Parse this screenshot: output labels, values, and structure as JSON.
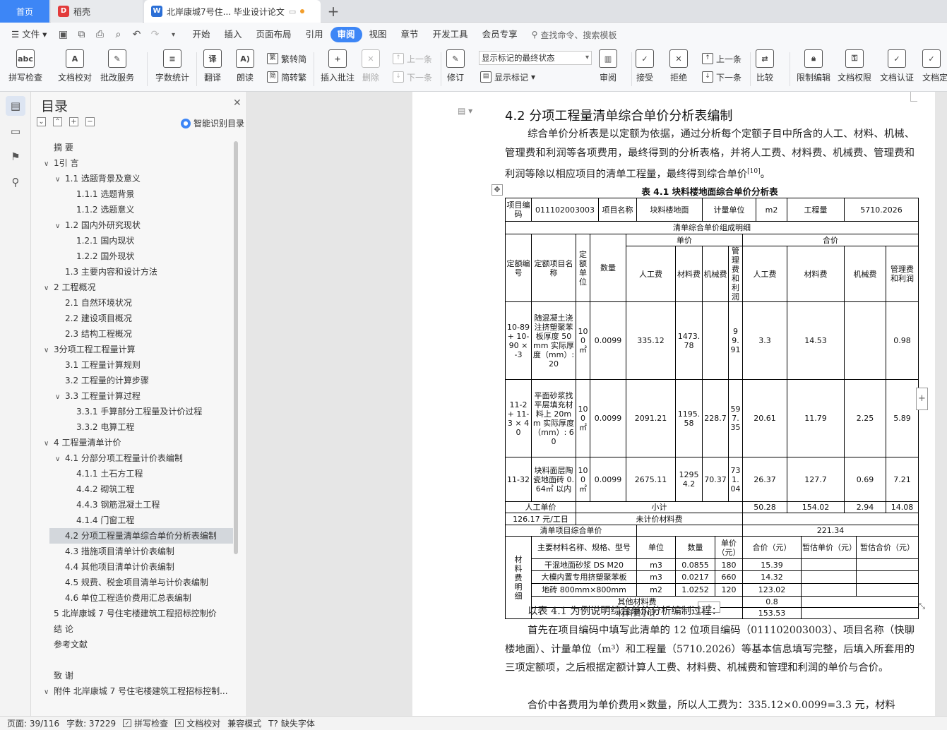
{
  "tabs": {
    "home": "首页",
    "daoke": "稻壳",
    "doc": "北岸康城7号住... 毕业设计论文",
    "new_tab": "+"
  },
  "menu": {
    "file": "文件",
    "items": [
      "开始",
      "插入",
      "页面布局",
      "引用",
      "审阅",
      "视图",
      "章节",
      "开发工具",
      "会员专享"
    ],
    "active": "审阅",
    "search": "查找命令、搜索模板"
  },
  "ribbon": {
    "spell_check": "拼写检查",
    "doc_proof": "文档校对",
    "batch_service": "批改服务",
    "word_count": "字数统计",
    "translate": "翻译",
    "read_aloud": "朗读",
    "to_trad": "繁转简",
    "to_simp": "简转繁",
    "insert_comment": "插入批注",
    "delete": "删除",
    "prev_comment": "上一条",
    "next_comment": "下一条",
    "revise": "修订",
    "markup_state": "显示标记的最终状态",
    "show_markup": "显示标记",
    "review": "审阅",
    "accept": "接受",
    "reject": "拒绝",
    "prev_change": "上一条",
    "next_change": "下一条",
    "compare": "比较",
    "restrict": "限制编辑",
    "permission": "文档权限",
    "certify": "文档认证",
    "finalize": "文档定稿"
  },
  "toc": {
    "title": "目录",
    "smart": "智能识别目录",
    "items": [
      {
        "text": "摘  要",
        "level": 0,
        "arrow": ""
      },
      {
        "text": "1引  言",
        "level": 0,
        "arrow": "v"
      },
      {
        "text": "1.1 选题背景及意义",
        "level": 1,
        "arrow": "v"
      },
      {
        "text": "1.1.1  选题背景",
        "level": 2,
        "arrow": ""
      },
      {
        "text": "1.1.2  选题意义",
        "level": 2,
        "arrow": ""
      },
      {
        "text": "1.2  国内外研究现状",
        "level": 1,
        "arrow": "v"
      },
      {
        "text": "1.2.1  国内现状",
        "level": 2,
        "arrow": ""
      },
      {
        "text": "1.2.2  国外现状",
        "level": 2,
        "arrow": ""
      },
      {
        "text": "1.3  主要内容和设计方法",
        "level": 1,
        "arrow": ""
      },
      {
        "text": "2  工程概况",
        "level": 0,
        "arrow": "v"
      },
      {
        "text": "2.1  自然环境状况",
        "level": 1,
        "arrow": ""
      },
      {
        "text": "2.2  建设项目概况",
        "level": 1,
        "arrow": ""
      },
      {
        "text": "2.3  结构工程概况",
        "level": 1,
        "arrow": ""
      },
      {
        "text": "3分项工程工程量计算",
        "level": 0,
        "arrow": "v"
      },
      {
        "text": "3.1  工程量计算规则",
        "level": 1,
        "arrow": ""
      },
      {
        "text": "3.2  工程量的计算步骤",
        "level": 1,
        "arrow": ""
      },
      {
        "text": "3.3  工程量计算过程",
        "level": 1,
        "arrow": "v"
      },
      {
        "text": "3.3.1  手算部分工程量及计价过程",
        "level": 2,
        "arrow": ""
      },
      {
        "text": "3.3.2  电算工程",
        "level": 2,
        "arrow": ""
      },
      {
        "text": "4  工程量清单计价",
        "level": 0,
        "arrow": "v"
      },
      {
        "text": "4.1  分部分项工程量计价表编制",
        "level": 1,
        "arrow": "v"
      },
      {
        "text": "4.1.1  土石方工程",
        "level": 2,
        "arrow": ""
      },
      {
        "text": "4.4.2  砌筑工程",
        "level": 2,
        "arrow": ""
      },
      {
        "text": "4.4.3  钢筋混凝土工程",
        "level": 2,
        "arrow": ""
      },
      {
        "text": "4.1.4  门窗工程",
        "level": 2,
        "arrow": ""
      },
      {
        "text": "4.2  分项工程量清单综合单价分析表编制",
        "level": 1,
        "arrow": "",
        "selected": true
      },
      {
        "text": "4.3  措施项目清单计价表编制",
        "level": 1,
        "arrow": ""
      },
      {
        "text": "4.4  其他项目清单计价表编制",
        "level": 1,
        "arrow": ""
      },
      {
        "text": "4.5  规费、税金项目清单与计价表编制",
        "level": 1,
        "arrow": ""
      },
      {
        "text": "4.6  单位工程造价费用汇总表编制",
        "level": 1,
        "arrow": ""
      },
      {
        "text": "5  北岸康城 7 号住宅楼建筑工程招标控制价",
        "level": 0,
        "arrow": ""
      },
      {
        "text": "结  论",
        "level": 0,
        "arrow": ""
      },
      {
        "text": "参考文献",
        "level": 0,
        "arrow": ""
      },
      {
        "text": "致  谢",
        "level": 0,
        "arrow": "",
        "gap": true
      },
      {
        "text": "附件  北岸康城 7 号住宅楼建筑工程招标控制...",
        "level": 0,
        "arrow": "v"
      }
    ]
  },
  "doc": {
    "heading": "4.2  分项工程量清单综合单价分析表编制",
    "para1": "综合单价分析表是以定额为依据，通过分析每个定额子目中所含的人工、材料、机械、管理费和利润等各项费用，最终得到的分析表格，并将人工费、材料费、机械费、管理费和利润等除以相应项目的清单工程量，最终得到综合单价",
    "para1_ref": "[10]",
    "para1_end": "。",
    "caption": "表 4.1  块料楼地面综合单价分析表",
    "para2": "以表 4.1 为例说明综合单价分析编制过程：",
    "para3": "首先在项目编码中填写此清单的 12 位项目编码（011102003003）、项目名称（快聊楼地面）、计量单位（m³）和工程量（5710.2026）等基本信息填写完整，后填入所套用的三项定额项，之后根据定额计算人工费、材料费、机械费和管理和利润的单价与合价。",
    "para4": "合价中各费用为单价费用×数量，所以人工费为：335.12×0.0099=3.3 元，材料"
  },
  "table": {
    "r1": [
      "项目编码",
      "011102003003",
      "项目名称",
      "块料楼地面",
      "计量单位",
      "m2",
      "工程量",
      "5710.2026"
    ],
    "detail_title": "清单综合单价组成明细",
    "h_code": "定额编号",
    "h_name": "定额项目名称",
    "h_unit": "定额单位",
    "h_qty": "数量",
    "h_unitprice": "单价",
    "h_total": "合价",
    "h_sub": [
      "人工费",
      "材料费",
      "机械费",
      "管理费和利润",
      "人工费",
      "材料费",
      "机械费",
      "管理费和利润"
    ],
    "rows": [
      {
        "code": "10-89 + 10-90 × -3",
        "name": "随混凝土浇注挤塑聚苯板厚度 50mm 实际厚度（mm）: 20",
        "unit": "100 ㎡",
        "qty": "0.0099",
        "v": [
          "335.12",
          "1473.78",
          "",
          "99.91",
          "3.3",
          "14.53",
          "",
          "0.98"
        ]
      },
      {
        "code": "11-2 + 11-3 × 40",
        "name": "平面砂浆找平层填充材料上 20mm 实际厚度（mm）: 60",
        "unit": "100 ㎡",
        "qty": "0.0099",
        "v": [
          "2091.21",
          "1195.58",
          "228.7",
          "597.35",
          "20.61",
          "11.79",
          "2.25",
          "5.89"
        ]
      },
      {
        "code": "11-32",
        "name": "块料面层陶瓷地面砖 0.64㎡ 以内",
        "unit": "100 ㎡",
        "qty": "0.0099",
        "v": [
          "2675.11",
          "12954.2",
          "70.37",
          "731.04",
          "26.37",
          "127.7",
          "0.69",
          "7.21"
        ]
      }
    ],
    "labor_label": "人工单价",
    "subtotal_label": "小计",
    "subtotal": [
      "50.28",
      "154.02",
      "2.94",
      "14.08"
    ],
    "labor_price": "126.17 元/工日",
    "unpriced": "未计价材料费",
    "comp_label": "清单项目综合单价",
    "comp_value": "221.34",
    "mat_side": "材料费明细",
    "mat_headers": [
      "主要材料名称、规格、型号",
      "单位",
      "数量",
      "单价（元）",
      "合价（元）",
      "暂估单价（元）",
      "暂估合价（元）"
    ],
    "mat_rows": [
      [
        "干混地面砂浆 DS M20",
        "m3",
        "0.0855",
        "180",
        "15.39",
        "",
        ""
      ],
      [
        "大模内置专用挤塑聚苯板",
        "m3",
        "0.0217",
        "660",
        "14.32",
        "",
        ""
      ],
      [
        "地砖 800mm×800mm",
        "m2",
        "1.0252",
        "120",
        "123.02",
        "",
        ""
      ]
    ],
    "other_label": "其他材料费",
    "other_value": "0.8",
    "matsub_label": "材料费小计",
    "matsub_value": "153.53"
  },
  "status": {
    "page": "页面: 39/116",
    "words": "字数: 37229",
    "spell": "拼写检查",
    "proof": "文档校对",
    "compat": "兼容模式",
    "missing_font": "缺失字体"
  }
}
